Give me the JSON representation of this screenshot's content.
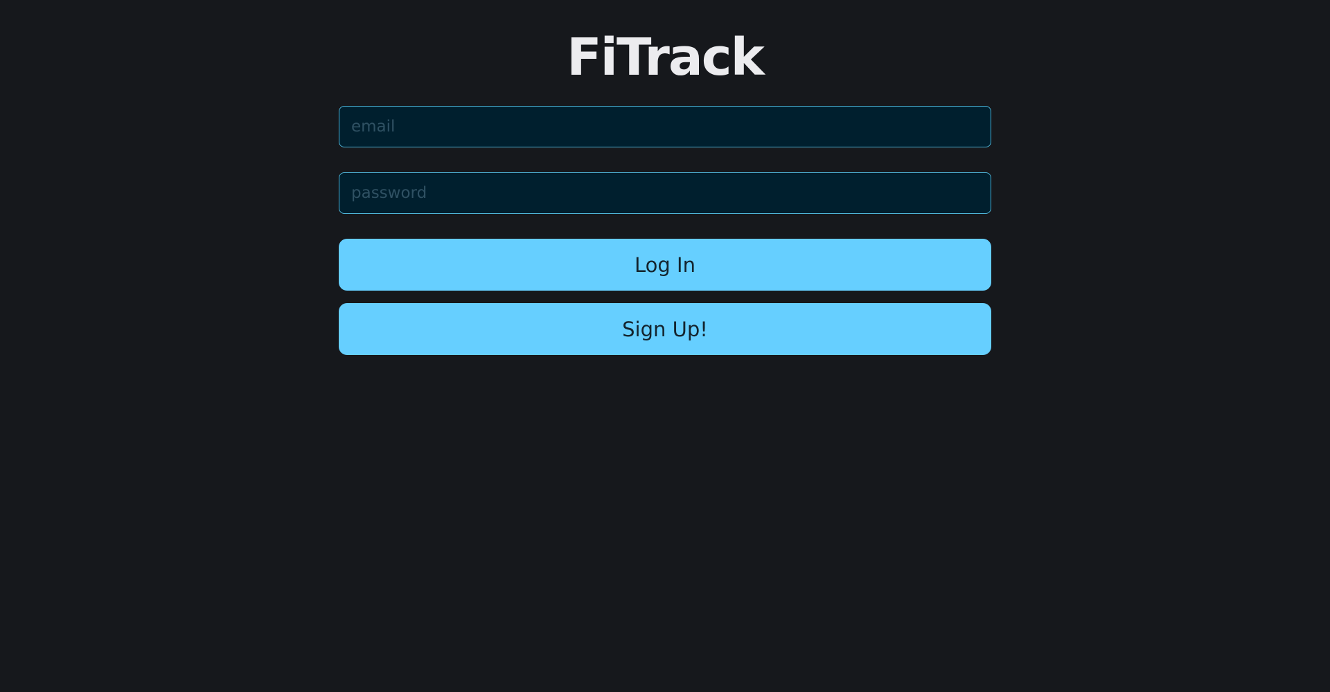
{
  "app": {
    "title": "FiTrack"
  },
  "login_form": {
    "email": {
      "value": "",
      "placeholder": "email"
    },
    "password": {
      "value": "",
      "placeholder": "password"
    },
    "login_label": "Log In",
    "signup_label": "Sign Up!"
  },
  "colors": {
    "background": "#16181c",
    "input_background": "#001f2e",
    "input_border": "#4cb4d8",
    "button_background": "#66cfff",
    "button_text": "#14242e",
    "title_text": "#ececef"
  }
}
